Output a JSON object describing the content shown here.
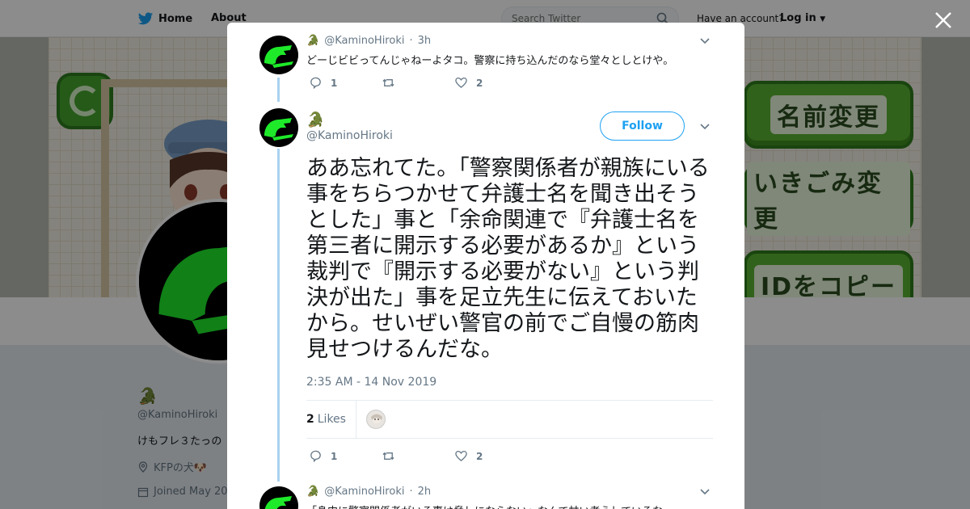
{
  "topbar": {
    "home_label": "Home",
    "about_label": "About",
    "search_placeholder": "Search Twitter",
    "account_prompt": "Have an account?",
    "login_label": "Log in"
  },
  "banner": {
    "buttons": [
      "名前変更",
      "いきごみ変更",
      "IDをコピー"
    ]
  },
  "profile": {
    "display_name": "🐊",
    "handle": "@KaminoHiroki",
    "bio": "けもフレ３たっの",
    "location": "KFPの犬🐶",
    "joined": "Joined May 20"
  },
  "modal": {
    "prev_tweet": {
      "handle": "@KaminoHiroki",
      "time": "3h",
      "text": "どーじビビってんじゃねーよタコ。警察に持ち込んだのなら堂々としとけや。",
      "replies": "1",
      "retweets": "",
      "likes": "2"
    },
    "main_tweet": {
      "display_name": "🐊",
      "handle": "@KaminoHiroki",
      "follow_label": "Follow",
      "text": "ああ忘れてた。「警察関係者が親族にいる事をちらつかせて弁護士名を聞き出そうとした」事と「余命関連で『弁護士名を第三者に開示する必要があるか』という裁判で『開示する必要がない』という判決が出た」事を足立先生に伝えておいたから。せいぜい警官の前でご自慢の筋肉見せつけるんだな。",
      "timestamp": "2:35 AM - 14 Nov 2019",
      "likes_count": "2",
      "likes_label": "Likes",
      "replies": "1",
      "retweets": "",
      "likes": "2"
    },
    "next_tweet": {
      "handle": "@KaminoHiroki",
      "time": "2h",
      "text": "「身内に警察関係者がいる事は脅しにならない」なんて甘い考えしているな"
    }
  },
  "colors": {
    "accent": "#1da1f2",
    "croc_green": "#27a31d",
    "thread_line": "#a9d2f0"
  }
}
